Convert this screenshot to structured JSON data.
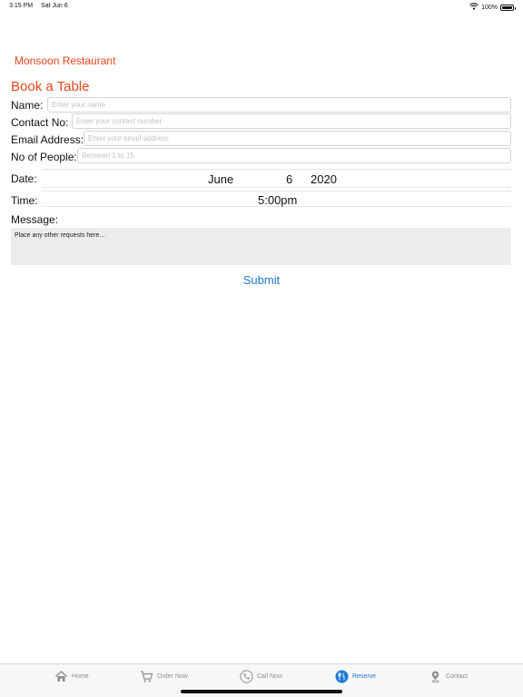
{
  "status_bar": {
    "time": "3:15 PM",
    "date": "Sat Jun 6",
    "battery": "100%",
    "battery_level": 1.0
  },
  "header": {
    "restaurant_name": "Monsoon Restaurant",
    "title": "Book a Table"
  },
  "form": {
    "name": {
      "label": "Name:",
      "placeholder": "Enter your name",
      "value": ""
    },
    "contact": {
      "label": "Contact No:",
      "placeholder": "Enter your contact number",
      "value": ""
    },
    "email": {
      "label": "Email Address:",
      "placeholder": "Enter your email address",
      "value": ""
    },
    "people": {
      "label": "No of People:",
      "placeholder": "Between 1 to 15",
      "value": ""
    },
    "date": {
      "label": "Date:",
      "month": "June",
      "day": "6",
      "year": "2020"
    },
    "time": {
      "label": "Time:",
      "value": "5:00pm"
    },
    "message": {
      "label": "Message:",
      "placeholder": "Place any other requests here..."
    },
    "submit_label": "Submit"
  },
  "tabs": [
    {
      "label": "Home",
      "icon": "home-icon",
      "active": false
    },
    {
      "label": "Order Now",
      "icon": "cart-icon",
      "active": false
    },
    {
      "label": "Call Now",
      "icon": "phone-icon",
      "active": false
    },
    {
      "label": "Reserve",
      "icon": "reserve-icon",
      "active": true
    },
    {
      "label": "Contact",
      "icon": "location-pin-icon",
      "active": false
    }
  ],
  "colors": {
    "accent": "#e8461c",
    "link": "#1a7ad6",
    "tab_inactive": "#8e8e93"
  }
}
